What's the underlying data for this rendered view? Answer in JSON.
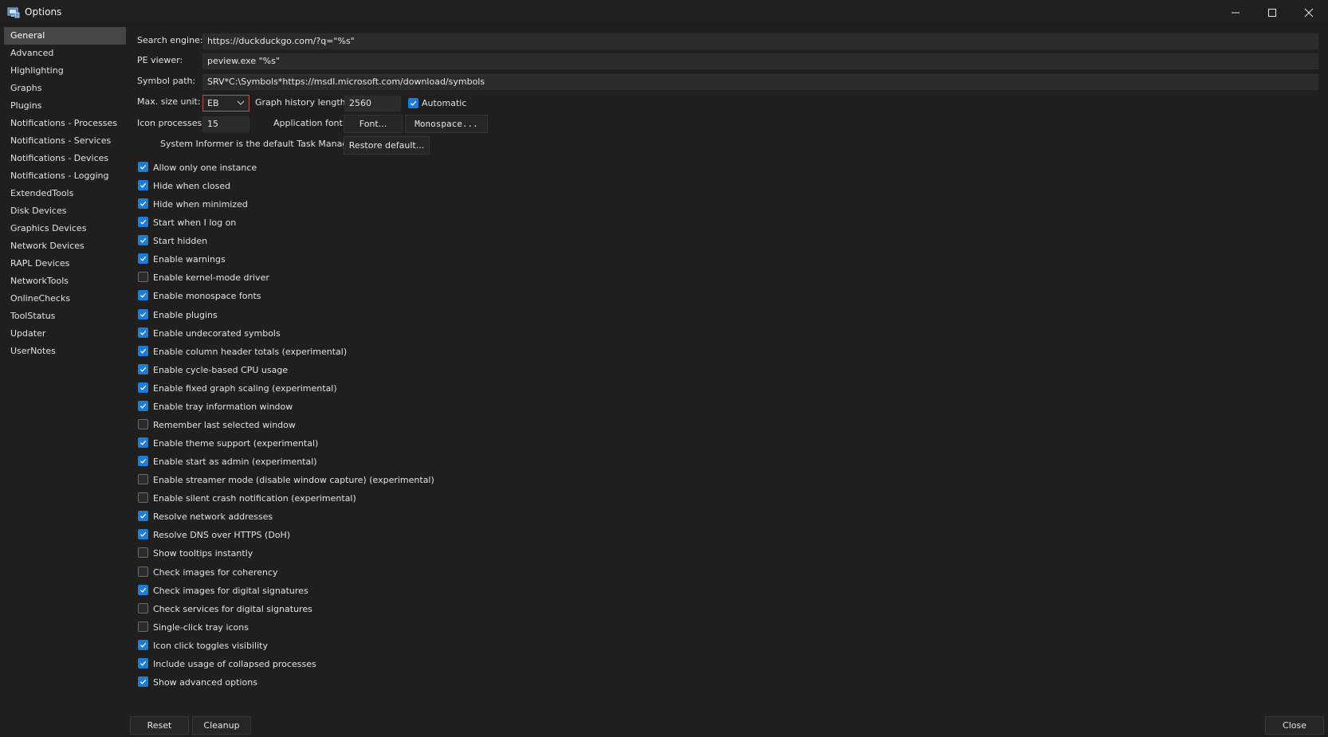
{
  "window": {
    "title": "Options",
    "icon": "system-informer-app-icon",
    "controls": [
      "minimize-icon",
      "maximize-icon",
      "close-icon"
    ]
  },
  "sidebar": {
    "items": [
      {
        "label": "General",
        "selected": true
      },
      {
        "label": "Advanced"
      },
      {
        "label": "Highlighting"
      },
      {
        "label": "Graphs"
      },
      {
        "label": "Plugins"
      },
      {
        "label": "Notifications - Processes"
      },
      {
        "label": "Notifications - Services"
      },
      {
        "label": "Notifications - Devices"
      },
      {
        "label": "Notifications - Logging"
      },
      {
        "label": "ExtendedTools"
      },
      {
        "label": "Disk Devices"
      },
      {
        "label": "Graphics Devices"
      },
      {
        "label": "Network Devices"
      },
      {
        "label": "RAPL Devices"
      },
      {
        "label": "NetworkTools"
      },
      {
        "label": "OnlineChecks"
      },
      {
        "label": "ToolStatus"
      },
      {
        "label": "Updater"
      },
      {
        "label": "UserNotes"
      }
    ]
  },
  "general": {
    "search_engine_label": "Search engine:",
    "search_engine_value": "https://duckduckgo.com/?q=\"%s\"",
    "pe_viewer_label": "PE viewer:",
    "pe_viewer_value": "peview.exe \"%s\"",
    "symbol_path_label": "Symbol path:",
    "symbol_path_value": "SRV*C:\\Symbols*https://msdl.microsoft.com/download/symbols",
    "max_size_unit_label": "Max. size unit:",
    "max_size_unit_value": "EB",
    "graph_history_label": "Graph history length:",
    "graph_history_value": "2560",
    "automatic_label": "Automatic",
    "automatic_checked": true,
    "icon_processes_label": "Icon processes:",
    "icon_processes_value": "15",
    "application_font_label": "Application font:",
    "font_button": "Font...",
    "monospace_button": "Monospace...",
    "task_manager_label": "System Informer is the default Task Manager:",
    "restore_default_button": "Restore default..."
  },
  "options": [
    {
      "label": "Allow only one instance",
      "checked": true
    },
    {
      "label": "Hide when closed",
      "checked": true
    },
    {
      "label": "Hide when minimized",
      "checked": true
    },
    {
      "label": "Start when I log on",
      "checked": true
    },
    {
      "label": "Start hidden",
      "checked": true
    },
    {
      "label": "Enable warnings",
      "checked": true
    },
    {
      "label": "Enable kernel-mode driver",
      "checked": false
    },
    {
      "label": "Enable monospace fonts",
      "checked": true
    },
    {
      "label": "Enable plugins",
      "checked": true
    },
    {
      "label": "Enable undecorated symbols",
      "checked": true
    },
    {
      "label": "Enable column header totals (experimental)",
      "checked": true
    },
    {
      "label": "Enable cycle-based CPU usage",
      "checked": true
    },
    {
      "label": "Enable fixed graph scaling (experimental)",
      "checked": true
    },
    {
      "label": "Enable tray information window",
      "checked": true
    },
    {
      "label": "Remember last selected window",
      "checked": false
    },
    {
      "label": "Enable theme support (experimental)",
      "checked": true
    },
    {
      "label": "Enable start as admin (experimental)",
      "checked": true
    },
    {
      "label": "Enable streamer mode (disable window capture) (experimental)",
      "checked": false
    },
    {
      "label": "Enable silent crash notification (experimental)",
      "checked": false
    },
    {
      "label": "Resolve network addresses",
      "checked": true
    },
    {
      "label": "Resolve DNS over HTTPS (DoH)",
      "checked": true
    },
    {
      "label": "Show tooltips instantly",
      "checked": false
    },
    {
      "label": "Check images for coherency",
      "checked": false
    },
    {
      "label": "Check images for digital signatures",
      "checked": true
    },
    {
      "label": "Check services for digital signatures",
      "checked": false
    },
    {
      "label": "Single-click tray icons",
      "checked": false
    },
    {
      "label": "Icon click toggles visibility",
      "checked": true
    },
    {
      "label": "Include usage of collapsed processes",
      "checked": true
    },
    {
      "label": "Show advanced options",
      "checked": true
    }
  ],
  "footer": {
    "reset_button": "Reset",
    "cleanup_button": "Cleanup",
    "close_button": "Close"
  },
  "colors": {
    "background": "#1f1f1f",
    "accent": "#1c7dd6",
    "combo_border": "#c0524e",
    "selected_item": "#454545"
  }
}
